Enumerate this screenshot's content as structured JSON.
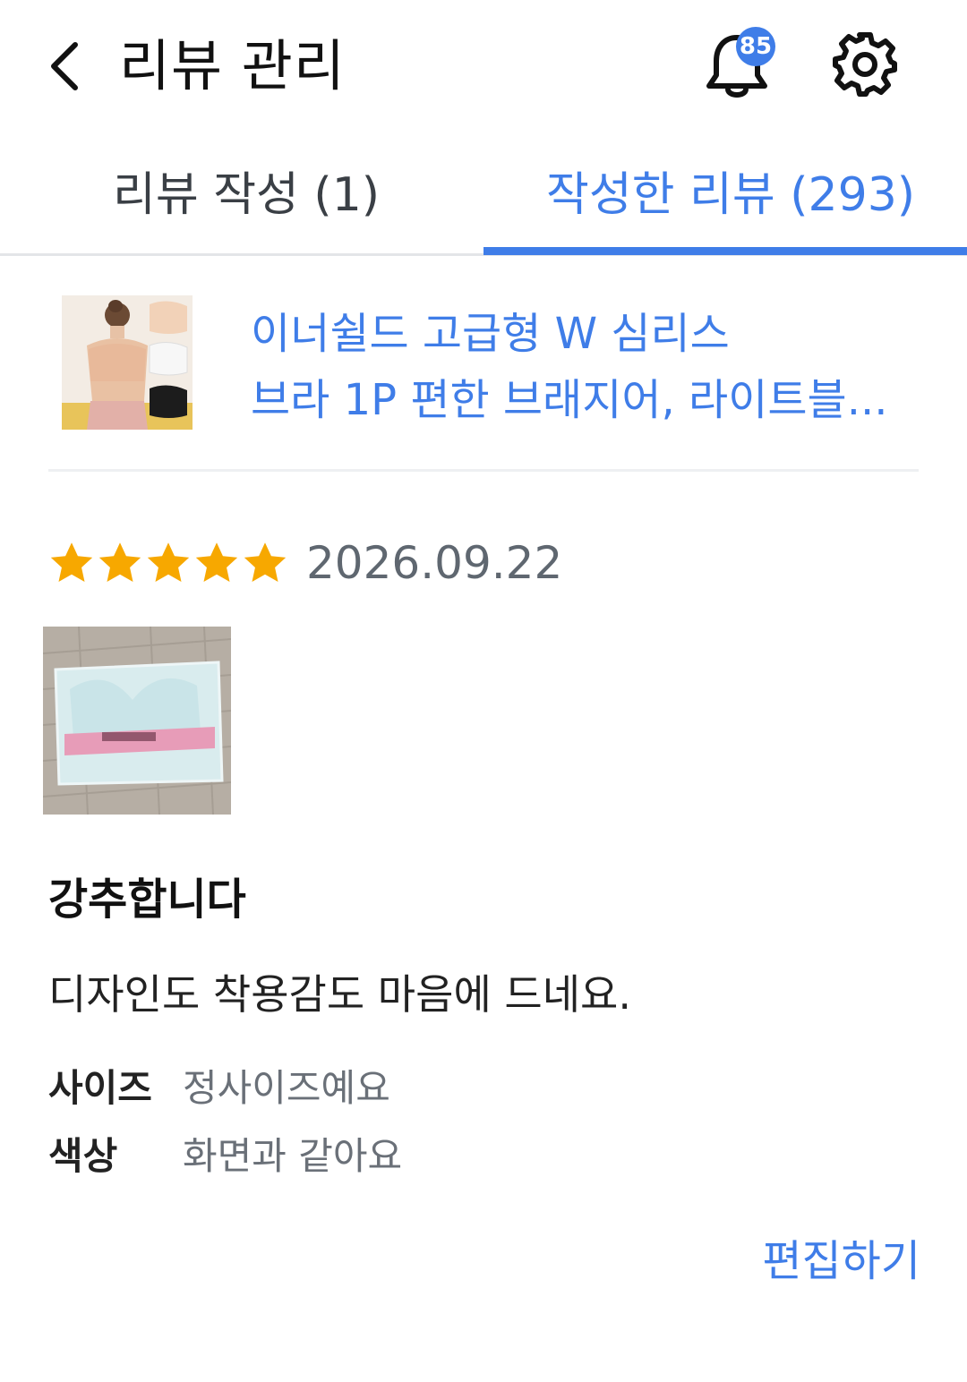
{
  "header": {
    "title": "리뷰 관리",
    "notification_count": "85",
    "icons": {
      "back": "chevron-left-icon",
      "bell": "bell-icon",
      "settings": "gear-icon"
    }
  },
  "tabs": [
    {
      "label": "리뷰 작성 (1)",
      "active": false
    },
    {
      "label": "작성한 리뷰 (293)",
      "active": true
    }
  ],
  "product": {
    "name_line1": "이너쉴드 고급형 W 심리스",
    "name_line2": "브라 1P 편한 브래지어, 라이트블..."
  },
  "review": {
    "rating": 5,
    "rating_max": 5,
    "date": "2026.09.22",
    "headline": "강추합니다",
    "body": "디자인도 착용감도 마음에 드네요.",
    "attributes": [
      {
        "label": "사이즈",
        "value": "정사이즈예요"
      },
      {
        "label": "색상",
        "value": "화면과 같아요"
      }
    ],
    "edit_label": "편집하기"
  },
  "colors": {
    "accent": "#3f7de8",
    "star": "#f7a800",
    "text_primary": "#111111",
    "text_muted": "#6a7078"
  }
}
